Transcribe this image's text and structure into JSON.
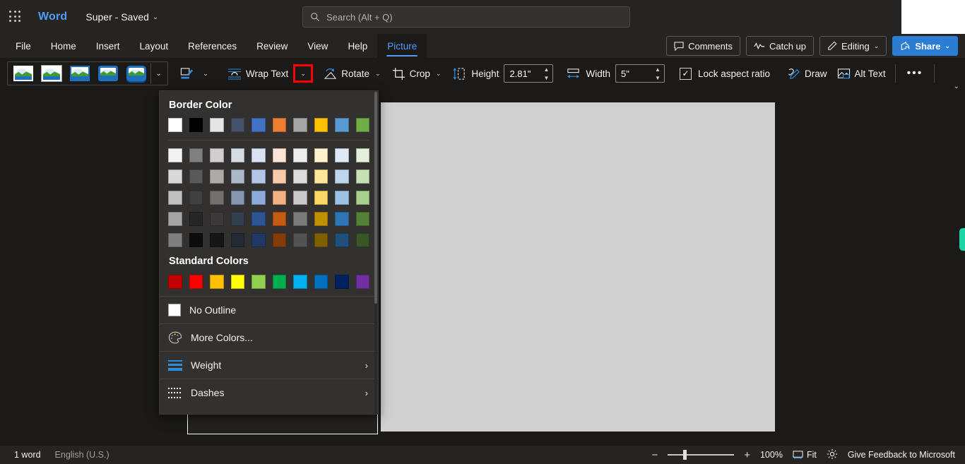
{
  "titlebar": {
    "waffle_icon": "app-launcher-icon",
    "app_name": "Word",
    "document_title": "Super  -  Saved",
    "title_chevron": "⌄",
    "search_placeholder": "Search (Alt + Q)",
    "search_icon": "search-icon"
  },
  "ribbon": {
    "tabs": [
      {
        "label": "File",
        "active": false
      },
      {
        "label": "Home",
        "active": false
      },
      {
        "label": "Insert",
        "active": false
      },
      {
        "label": "Layout",
        "active": false
      },
      {
        "label": "References",
        "active": false
      },
      {
        "label": "Review",
        "active": false
      },
      {
        "label": "View",
        "active": false
      },
      {
        "label": "Help",
        "active": false
      },
      {
        "label": "Picture",
        "active": true
      }
    ],
    "actions": {
      "comments": "Comments",
      "catch_up": "Catch up",
      "editing": "Editing",
      "share": "Share",
      "chevron": "⌄"
    },
    "accent_color": "#4f9cf9",
    "share_color": "#2b7cd3"
  },
  "commandbar": {
    "gallery_label": "picture-styles-gallery",
    "gallery_more": "⌄",
    "border_label": "picture-border",
    "wrap_text": "Wrap Text",
    "wrap_text_chevron": "⌄",
    "wrap_highlight_color": "#ff0000",
    "rotate": "Rotate",
    "crop": "Crop",
    "height_label": "Height",
    "height_value": "2.81\"",
    "width_label": "Width",
    "width_value": "5\"",
    "lock_aspect_ratio": "Lock aspect ratio",
    "lock_checked": "✓",
    "draw": "Draw",
    "alt_text": "Alt Text",
    "overflow": "•••",
    "collapse_chevron": "⌄"
  },
  "dropdown": {
    "title": "Border Color",
    "standard_title": "Standard Colors",
    "theme_row_base": [
      "#ffffff",
      "#000000",
      "#e6e6e6",
      "#44546a",
      "#4472c4",
      "#ed7d31",
      "#a5a5a5",
      "#ffc000",
      "#5b9bd5",
      "#70ad47"
    ],
    "theme_shades": [
      [
        "#f2f2f2",
        "#808080",
        "#d0cece",
        "#d6dce4",
        "#d9e2f3",
        "#fbe5d6",
        "#ededed",
        "#fff2cc",
        "#deebf6",
        "#e2efd9"
      ],
      [
        "#d9d9d9",
        "#595959",
        "#aeaaaa",
        "#adb9ca",
        "#b4c6e7",
        "#f7caac",
        "#dbdbdb",
        "#ffe598",
        "#bdd7ee",
        "#c5e0b3"
      ],
      [
        "#bfbfbf",
        "#404040",
        "#757070",
        "#8496b0",
        "#8eaadb",
        "#f4b083",
        "#c9c9c9",
        "#ffd965",
        "#9cc3e5",
        "#a8d08d"
      ],
      [
        "#a5a5a5",
        "#262626",
        "#3a3838",
        "#333f4f",
        "#2f5496",
        "#c55a11",
        "#7b7b7b",
        "#bf9000",
        "#2e75b5",
        "#538135"
      ],
      [
        "#7f7f7f",
        "#0c0c0c",
        "#171616",
        "#222a35",
        "#1f3864",
        "#843c0b",
        "#525252",
        "#7f6000",
        "#1e4e79",
        "#375623"
      ]
    ],
    "standard_colors": [
      "#c00000",
      "#ff0000",
      "#ffc000",
      "#ffff00",
      "#92d050",
      "#00b050",
      "#00b0f0",
      "#0070c0",
      "#002060",
      "#7030a0"
    ],
    "items": [
      {
        "label": "No Outline",
        "icon": "no-outline-icon",
        "arrow": ""
      },
      {
        "label": "More Colors...",
        "icon": "palette-icon",
        "arrow": ""
      },
      {
        "label": "Weight",
        "icon": "line-weight-icon",
        "arrow": "›"
      },
      {
        "label": "Dashes",
        "icon": "line-dashes-icon",
        "arrow": "›"
      }
    ]
  },
  "canvas": {
    "page_color": "#d0d0d0",
    "side_tab_color": "#1ed6a5"
  },
  "statusbar": {
    "word_count": "1 word",
    "language": "English (U.S.)",
    "zoom_minus": "−",
    "zoom_plus": "+",
    "zoom_level": "100%",
    "fit": "Fit",
    "brightness_icon": "brightness-icon",
    "feedback": "Give Feedback to Microsoft"
  }
}
